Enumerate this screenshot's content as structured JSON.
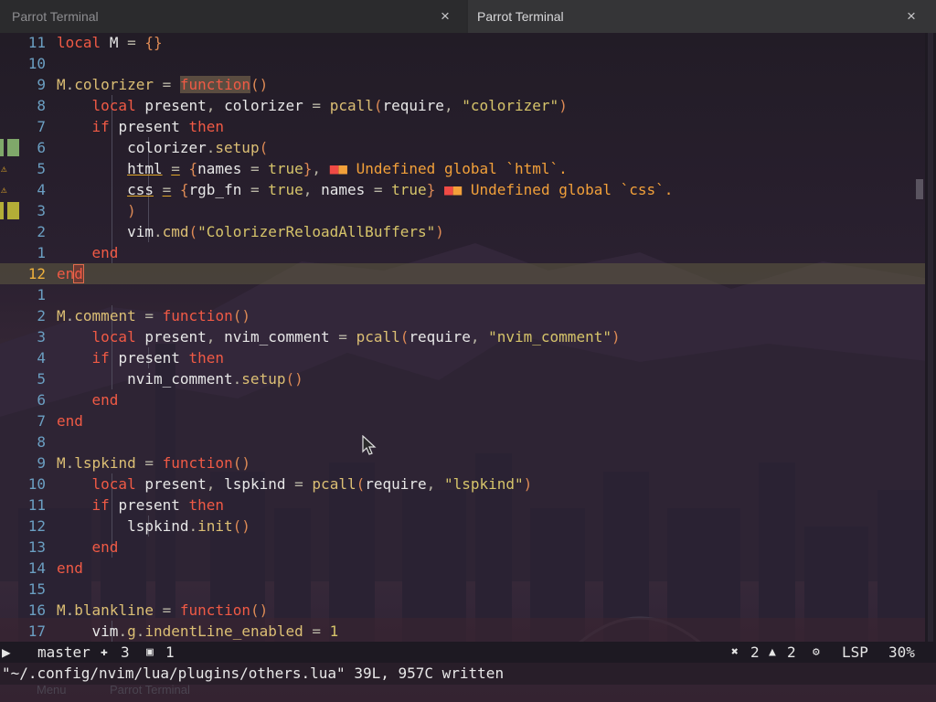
{
  "tabs": [
    {
      "title": "Parrot Terminal",
      "close": "×"
    },
    {
      "title": "Parrot Terminal",
      "close": "×"
    }
  ],
  "editor": {
    "lines": [
      {
        "num": "11",
        "cur": false,
        "sign": "",
        "html": "<span class='kw'>local</span> <span class='id'>M</span> <span class='pu'>=</span> <span class='br'>{}</span>"
      },
      {
        "num": "10",
        "cur": false,
        "sign": "",
        "html": ""
      },
      {
        "num": "9",
        "cur": false,
        "sign": "",
        "html": "<span class='fn'>M</span><span class='pu'>.</span><span class='fn'>colorizer</span> <span class='pu'>=</span> <span class='hl-fn'>function</span><span class='br'>()</span>"
      },
      {
        "num": "8",
        "cur": false,
        "sign": "",
        "html": "    <span class='kw'>local</span> <span class='id'>present</span><span class='pu'>,</span> <span class='id'>colorizer</span> <span class='pu'>=</span> <span class='fn'>pcall</span><span class='br'>(</span><span class='id'>require</span><span class='pu'>,</span> <span class='str'>\"colorizer\"</span><span class='br'>)</span>"
      },
      {
        "num": "7",
        "cur": false,
        "sign": "",
        "html": "    <span class='kw'>if</span> <span class='id'>present</span> <span class='kw'>then</span>"
      },
      {
        "num": "6",
        "cur": false,
        "sign": "add",
        "html": "        <span class='id'>colorizer</span><span class='pu'>.</span><span class='fn'>setup</span><span class='br'>(</span>"
      },
      {
        "num": "5",
        "cur": false,
        "sign": "warn",
        "html": "        <span class='id undl'>html</span> <span class='pu undl'>=</span> <span class='br'>{</span><span class='id'>names</span> <span class='pu'>=</span> <span class='num'>true</span><span class='br'>}</span><span class='pu'>,</span> <span class='diag'><span class='sq'>■</span>■ Undefined global `html`.</span>"
      },
      {
        "num": "4",
        "cur": false,
        "sign": "warn",
        "html": "        <span class='id undl'>css</span> <span class='pu undl'>=</span> <span class='br'>{</span><span class='id'>rgb_fn</span> <span class='pu'>=</span> <span class='num'>true</span><span class='pu'>,</span> <span class='id'>names</span> <span class='pu'>=</span> <span class='num'>true</span><span class='br'>}</span> <span class='diag'><span class='sq'>■</span>■ Undefined global `css`.</span>"
      },
      {
        "num": "3",
        "cur": false,
        "sign": "chg",
        "html": "        <span class='br'>)</span>"
      },
      {
        "num": "2",
        "cur": false,
        "sign": "",
        "html": "        <span class='id'>vim</span><span class='pu'>.</span><span class='fn'>cmd</span><span class='br'>(</span><span class='str'>\"ColorizerReloadAllBuffers\"</span><span class='br'>)</span>"
      },
      {
        "num": "1",
        "cur": false,
        "sign": "",
        "html": "    <span class='kw'>end</span>"
      },
      {
        "num": "12",
        "cur": true,
        "sign": "",
        "html": "<span class='kw'>en</span><span class='hl-end'>d</span>"
      },
      {
        "num": "1",
        "cur": false,
        "sign": "",
        "html": ""
      },
      {
        "num": "2",
        "cur": false,
        "sign": "",
        "html": "<span class='fn'>M</span><span class='pu'>.</span><span class='fn'>comment</span> <span class='pu'>=</span> <span class='kw'>function</span><span class='br'>()</span>"
      },
      {
        "num": "3",
        "cur": false,
        "sign": "",
        "html": "    <span class='kw'>local</span> <span class='id'>present</span><span class='pu'>,</span> <span class='id'>nvim_comment</span> <span class='pu'>=</span> <span class='fn'>pcall</span><span class='br'>(</span><span class='id'>require</span><span class='pu'>,</span> <span class='str'>\"nvim_comment\"</span><span class='br'>)</span>"
      },
      {
        "num": "4",
        "cur": false,
        "sign": "",
        "html": "    <span class='kw'>if</span> <span class='id'>present</span> <span class='kw'>then</span>"
      },
      {
        "num": "5",
        "cur": false,
        "sign": "",
        "html": "        <span class='id'>nvim_comment</span><span class='pu'>.</span><span class='fn'>setup</span><span class='br'>()</span>"
      },
      {
        "num": "6",
        "cur": false,
        "sign": "",
        "html": "    <span class='kw'>end</span>"
      },
      {
        "num": "7",
        "cur": false,
        "sign": "",
        "html": "<span class='kw'>end</span>"
      },
      {
        "num": "8",
        "cur": false,
        "sign": "",
        "html": ""
      },
      {
        "num": "9",
        "cur": false,
        "sign": "",
        "html": "<span class='fn'>M</span><span class='pu'>.</span><span class='fn'>lspkind</span> <span class='pu'>=</span> <span class='kw'>function</span><span class='br'>()</span>"
      },
      {
        "num": "10",
        "cur": false,
        "sign": "",
        "html": "    <span class='kw'>local</span> <span class='id'>present</span><span class='pu'>,</span> <span class='id'>lspkind</span> <span class='pu'>=</span> <span class='fn'>pcall</span><span class='br'>(</span><span class='id'>require</span><span class='pu'>,</span> <span class='str'>\"lspkind\"</span><span class='br'>)</span>"
      },
      {
        "num": "11",
        "cur": false,
        "sign": "",
        "html": "    <span class='kw'>if</span> <span class='id'>present</span> <span class='kw'>then</span>"
      },
      {
        "num": "12",
        "cur": false,
        "sign": "",
        "html": "        <span class='id'>lspkind</span><span class='pu'>.</span><span class='fn'>init</span><span class='br'>()</span>"
      },
      {
        "num": "13",
        "cur": false,
        "sign": "",
        "html": "    <span class='kw'>end</span>"
      },
      {
        "num": "14",
        "cur": false,
        "sign": "",
        "html": "<span class='kw'>end</span>"
      },
      {
        "num": "15",
        "cur": false,
        "sign": "",
        "html": ""
      },
      {
        "num": "16",
        "cur": false,
        "sign": "",
        "html": "<span class='fn'>M</span><span class='pu'>.</span><span class='fn'>blankline</span> <span class='pu'>=</span> <span class='kw'>function</span><span class='br'>()</span>"
      },
      {
        "num": "17",
        "cur": false,
        "sign": "",
        "html": "    <span class='id'>vim</span><span class='pu'>.</span><span class='fn'>g</span><span class='pu'>.</span><span class='fn'>indentLine_enabled</span> <span class='pu'>=</span> <span class='num'>1</span>"
      }
    ]
  },
  "statusline": {
    "mode_icon": "▶",
    "branch_icon": "",
    "branch": "master",
    "added_icon": "✚",
    "added": "3",
    "changed_icon": "▣",
    "changed": "1",
    "errors_icon": "✖",
    "errors": "2",
    "warnings_icon": "▲",
    "warnings": "2",
    "lsp_icon": "⚙",
    "lsp": "LSP",
    "percent": "30%"
  },
  "cmdline": "\"~/.config/nvim/lua/plugins/others.lua\" 39L, 957C written",
  "taskbar": {
    "menu": "Menu",
    "app": "Parrot Terminal"
  },
  "colors": {
    "accent": "#f05a45",
    "linenr": "#6b9fc2",
    "current_linenr": "#f0b23c",
    "added": "#7fa86a",
    "changed": "#b3ad37",
    "warning": "#e2a829"
  }
}
